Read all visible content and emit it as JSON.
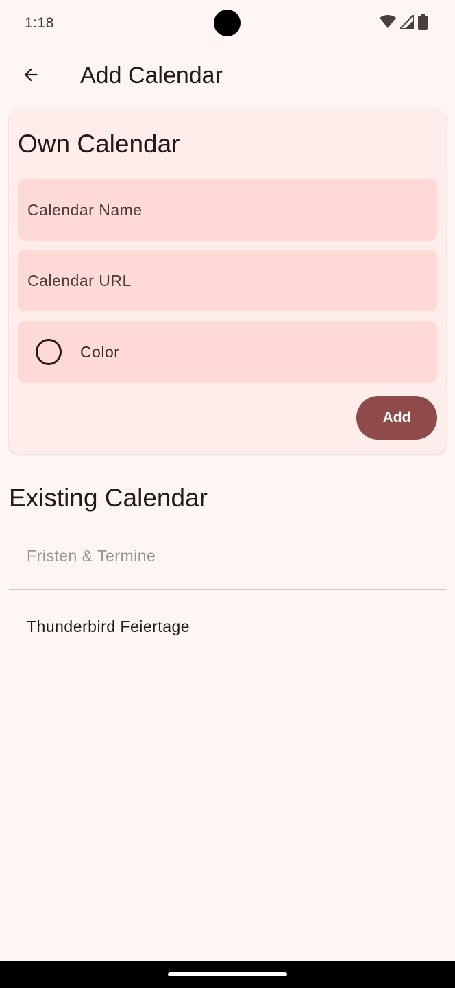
{
  "status_bar": {
    "time": "1:18",
    "icons": [
      "wifi-icon",
      "cellular-signal-icon",
      "battery-icon"
    ]
  },
  "app_bar": {
    "back_icon": "arrow-back-icon",
    "title": "Add Calendar"
  },
  "own_calendar": {
    "title": "Own Calendar",
    "name_field": {
      "placeholder": "Calendar Name",
      "value": ""
    },
    "url_field": {
      "placeholder": "Calendar URL",
      "value": ""
    },
    "color_field": {
      "label": "Color",
      "icon": "color-circle-icon"
    },
    "add_button": "Add"
  },
  "existing_calendar": {
    "title": "Existing Calendar",
    "items": [
      {
        "label": "Fristen & Termine",
        "state": "disabled"
      },
      {
        "label": "Thunderbird Feiertage",
        "state": "enabled"
      }
    ]
  },
  "colors": {
    "background": "#fff5f4",
    "card": "#ffedec",
    "field": "#ffd9d6",
    "accent": "#8f4a4a"
  }
}
